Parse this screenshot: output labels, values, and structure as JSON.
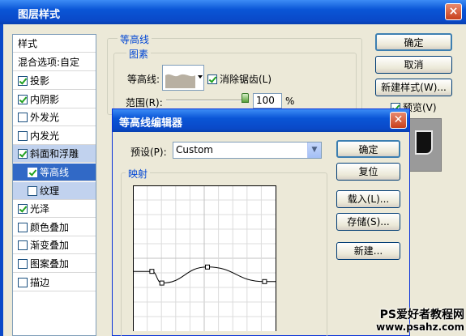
{
  "window": {
    "title": "图层样式",
    "close": "×"
  },
  "styles_list": {
    "header": "样式",
    "blend": "混合选项:自定",
    "items": [
      {
        "label": "投影",
        "checked": true
      },
      {
        "label": "内阴影",
        "checked": true
      },
      {
        "label": "外发光",
        "checked": false
      },
      {
        "label": "内发光",
        "checked": false
      },
      {
        "label": "斜面和浮雕",
        "checked": true
      },
      {
        "label": "等高线",
        "checked": true
      },
      {
        "label": "纹理",
        "checked": false
      },
      {
        "label": "光泽",
        "checked": true
      },
      {
        "label": "颜色叠加",
        "checked": false
      },
      {
        "label": "渐变叠加",
        "checked": false
      },
      {
        "label": "图案叠加",
        "checked": false
      },
      {
        "label": "描边",
        "checked": false
      }
    ]
  },
  "contour_panel": {
    "title": "等高线",
    "sub": "图素",
    "contour_label": "等高线:",
    "antialias_label": "消除锯齿(L)",
    "range_label": "范围(R):",
    "range_value": "100",
    "range_unit": "%"
  },
  "right_buttons": {
    "ok": "确定",
    "cancel": "取消",
    "new_style": "新建样式(W)...",
    "preview": "预览(V)"
  },
  "editor": {
    "title": "等高线编辑器",
    "preset_label": "预设(P):",
    "preset_value": "Custom",
    "mapping_label": "映射",
    "buttons": {
      "ok": "确定",
      "reset": "复位",
      "load": "载入(L)...",
      "save": "存储(S)...",
      "new": "新建..."
    },
    "curve_points": [
      [
        0,
        0.41
      ],
      [
        0.13,
        0.41
      ],
      [
        0.2,
        0.33
      ],
      [
        0.52,
        0.44
      ],
      [
        0.92,
        0.34
      ],
      [
        1,
        0.34
      ]
    ]
  },
  "watermark": {
    "line1": "PS爱好者教程网",
    "line2": "www.psahz.com"
  }
}
